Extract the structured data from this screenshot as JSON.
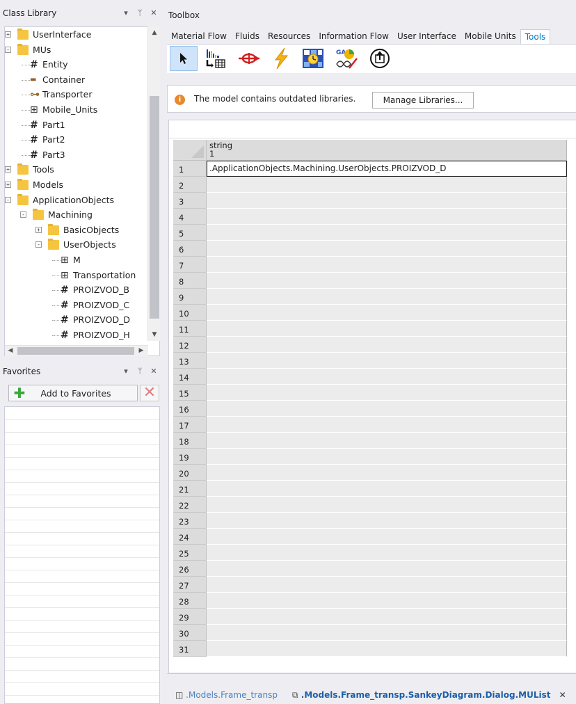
{
  "class_library": {
    "title": "Class Library",
    "tree": [
      {
        "label": "UserInterface",
        "kind": "folder",
        "level": 0,
        "expander": "+"
      },
      {
        "label": "MUs",
        "kind": "folder",
        "level": 0,
        "expander": "-"
      },
      {
        "label": "Entity",
        "kind": "entity",
        "level": 1
      },
      {
        "label": "Container",
        "kind": "container",
        "level": 1
      },
      {
        "label": "Transporter",
        "kind": "transporter",
        "level": 1
      },
      {
        "label": "Mobile_Units",
        "kind": "frame",
        "level": 1
      },
      {
        "label": "Part1",
        "kind": "entity",
        "level": 1
      },
      {
        "label": "Part2",
        "kind": "entity",
        "level": 1
      },
      {
        "label": "Part3",
        "kind": "entity",
        "level": 1
      },
      {
        "label": "Tools",
        "kind": "folder",
        "level": 0,
        "expander": "+"
      },
      {
        "label": "Models",
        "kind": "folder",
        "level": 0,
        "expander": "+"
      },
      {
        "label": "ApplicationObjects",
        "kind": "folder",
        "level": 0,
        "expander": "-"
      },
      {
        "label": "Machining",
        "kind": "folder",
        "level": 1,
        "expander": "-"
      },
      {
        "label": "BasicObjects",
        "kind": "folder",
        "level": 2,
        "expander": "+"
      },
      {
        "label": "UserObjects",
        "kind": "folder",
        "level": 2,
        "expander": "-"
      },
      {
        "label": "M",
        "kind": "frame",
        "level": 3
      },
      {
        "label": "Transportation",
        "kind": "frame",
        "level": 3
      },
      {
        "label": "PROIZVOD_B",
        "kind": "entity",
        "level": 3
      },
      {
        "label": "PROIZVOD_C",
        "kind": "entity",
        "level": 3
      },
      {
        "label": "PROIZVOD_D",
        "kind": "entity",
        "level": 3
      },
      {
        "label": "PROIZVOD_H",
        "kind": "entity",
        "level": 3
      }
    ]
  },
  "favorites": {
    "title": "Favorites",
    "add_label": "Add to Favorites"
  },
  "toolbox": {
    "title": "Toolbox",
    "tabs": [
      "Material Flow",
      "Fluids",
      "Resources",
      "Information Flow",
      "User Interface",
      "Mobile Units",
      "Tools"
    ],
    "active_tab": "Tools",
    "icons": [
      "pointer-icon",
      "chart-table-icon",
      "transfer-icon",
      "lightning-icon",
      "experiment-icon",
      "genetic-algorithm-icon",
      "upload-icon"
    ]
  },
  "message_bar": {
    "text": "The model contains outdated libraries.",
    "button_label": "Manage Libraries..."
  },
  "table": {
    "column_header": "string",
    "column_index": "1",
    "rows": [
      ".ApplicationObjects.Machining.UserObjects.PROIZVOD_D",
      "",
      "",
      "",
      "",
      "",
      "",
      "",
      "",
      "",
      "",
      "",
      "",
      "",
      "",
      "",
      "",
      "",
      "",
      "",
      "",
      "",
      "",
      "",
      "",
      "",
      "",
      "",
      "",
      "",
      ""
    ],
    "row_numbers": [
      "1",
      "2",
      "3",
      "4",
      "5",
      "6",
      "7",
      "8",
      "9",
      "10",
      "11",
      "12",
      "13",
      "14",
      "15",
      "16",
      "17",
      "18",
      "19",
      "20",
      "21",
      "22",
      "23",
      "24",
      "25",
      "26",
      "27",
      "28",
      "29",
      "30",
      "31"
    ]
  },
  "document_tabs": [
    {
      "label": ".Models.Frame_transp",
      "active": false
    },
    {
      "label": ".Models.Frame_transp.SankeyDiagram.Dialog.MUList",
      "active": true
    }
  ],
  "colors": {
    "accent": "#007acc",
    "selection": "#cfe3fb"
  }
}
